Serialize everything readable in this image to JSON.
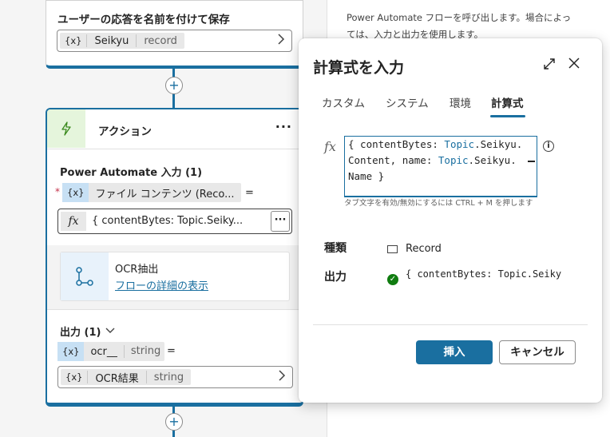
{
  "right_panel": {
    "description_line1": "Power Automate フローを呼び出します。場合によっ",
    "description_line2": "ては、入力と出力を使用します。"
  },
  "save_card": {
    "title": "ユーザーの応答を名前を付けて保存",
    "variable_icon": "{x}",
    "variable_name": "Seikyu",
    "variable_type": "record",
    "chevron_icon": "chevron-right-icon"
  },
  "add_node_symbol": "+",
  "action_card": {
    "header_title": "アクション",
    "header_icon": "lightning-icon",
    "more_label": "···",
    "inputs_section_label": "Power Automate 入力 (1)",
    "required_marker": "*",
    "input_variable_icon": "{x}",
    "input_variable_name": "ファイル コンテンツ (Reco...",
    "equals": "=",
    "formula_icon": "fx",
    "formula_preview": "{ contentBytes: Topic.Seiky...",
    "formula_more": "···",
    "flow": {
      "icon": "flow-icon",
      "name": "OCR抽出",
      "link": "フローの詳細の表示"
    },
    "outputs_section_label": "出力 (1)",
    "outputs_chevron": "chevron-down-icon",
    "output_variable_icon": "{x}",
    "output_variable_name": "ocr__",
    "output_variable_type": "string",
    "output_equals": "=",
    "output_target_icon": "{x}",
    "output_target_name": "OCR結果",
    "output_target_type": "string"
  },
  "modal": {
    "title": "計算式を入力",
    "expand_icon": "expand-icon",
    "close_icon": "close-icon",
    "tabs": [
      {
        "label": "カスタム",
        "active": false
      },
      {
        "label": "システム",
        "active": false
      },
      {
        "label": "環境",
        "active": false
      },
      {
        "label": "計算式",
        "active": true
      }
    ],
    "fx_label": "fx",
    "formula_line1_a": "{ contentBytes: ",
    "formula_line1_kw": "Topic",
    "formula_line1_b": ".Seikyu.",
    "formula_line2_a": "Content, name: ",
    "formula_line2_kw": "Topic",
    "formula_line2_b": ".Seikyu.",
    "formula_line3": "Name }",
    "info_icon": "i",
    "hint": "タブ文字を有効/無効にするには CTRL + M を押します",
    "type_label": "種類",
    "type_value": "Record",
    "output_label": "出力",
    "output_value": "{ contentBytes: Topic.Seiky",
    "insert_button": "挿入",
    "cancel_button": "キャンセル",
    "accent_color": "#1a6fa0",
    "success_color": "#107c10"
  }
}
